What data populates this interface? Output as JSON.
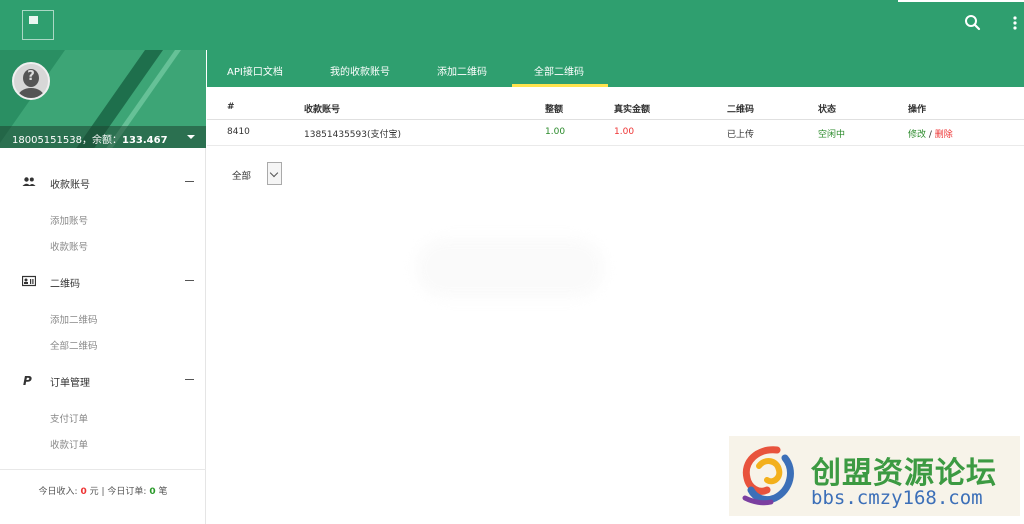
{
  "colors": {
    "brand_green": "#2f9f6f",
    "accent_yellow": "#ffe34d",
    "red": "#e33333",
    "green_text": "#2a8a2a"
  },
  "header": {
    "icons": [
      "logo-icon",
      "search-icon",
      "more-vert-icon"
    ]
  },
  "profile": {
    "account": "18005151538，余额：",
    "balance": "133.467"
  },
  "sidebar": {
    "groups": [
      {
        "label": "收款账号",
        "icon": "users-icon",
        "items": [
          "添加账号",
          "收款账号"
        ]
      },
      {
        "label": "二维码",
        "icon": "id-card-icon",
        "items": [
          "添加二维码",
          "全部二维码"
        ]
      },
      {
        "label": "订单管理",
        "icon": "paypal-icon",
        "items": [
          "支付订单",
          "收款订单"
        ]
      }
    ],
    "footer": {
      "income_label": "今日收入:",
      "income_value": "0",
      "income_unit": "元",
      "sep": "|",
      "orders_label": "今日订单:",
      "orders_value": "0",
      "orders_unit": "笔"
    }
  },
  "tabs": [
    "API接口文档",
    "我的收款账号",
    "添加二维码",
    "全部二维码"
  ],
  "active_tab": "全部二维码",
  "table": {
    "headers": [
      "#",
      "收款账号",
      "整额",
      "真实金额",
      "二维码",
      "状态",
      "操作"
    ],
    "rows": [
      {
        "id": "8410",
        "account": "13851435593(支付宝)",
        "amount": "1.00",
        "real_amount": "1.00",
        "qrcode": "已上传",
        "status": "空闲中",
        "edit": "修改",
        "sep": " / ",
        "delete": "删除"
      }
    ]
  },
  "filter": {
    "selected": "全部"
  },
  "watermark": {
    "title": "创盟资源论坛",
    "url": "bbs.cmzy168.com"
  }
}
